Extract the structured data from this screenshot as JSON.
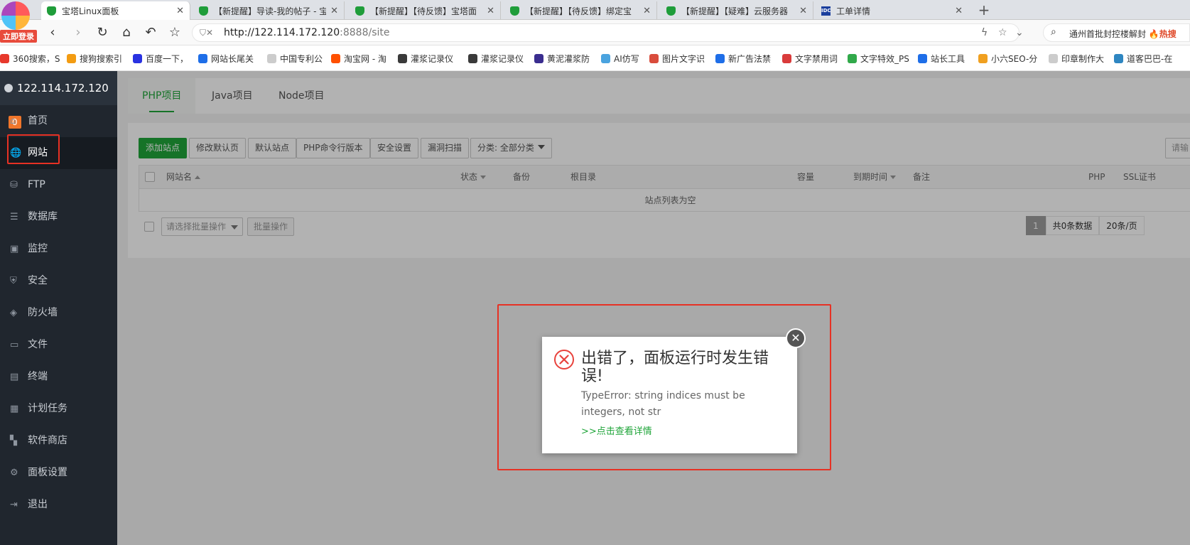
{
  "browser": {
    "login_badge": "立即登录",
    "tabs": [
      {
        "title": "宝塔Linux面板",
        "icon": "shield-icon"
      },
      {
        "title": "【新提醒】导读-我的帖子 - 宝",
        "icon": "shield-icon"
      },
      {
        "title": "【新提醒】【待反馈】宝塔面",
        "icon": "shield-icon"
      },
      {
        "title": "【新提醒】【待反馈】绑定宝",
        "icon": "shield-icon"
      },
      {
        "title": "【新提醒】【疑难】云服务器",
        "icon": "shield-icon"
      },
      {
        "title": "工单详情",
        "icon": "idc-icon"
      }
    ],
    "tab_close": "✕",
    "new_tab": "+",
    "url_host": "http://122.114.172.120",
    "url_path": ":8888/site",
    "search_text": "通州首批封控楼解封",
    "search_hot": "🔥热搜",
    "idc_badge": "IDC",
    "bookmarks": [
      {
        "label": "360搜索，S",
        "color": "#e7392c"
      },
      {
        "label": "搜狗搜索引",
        "color": "#f39c12"
      },
      {
        "label": "百度一下，",
        "color": "#2932e1"
      },
      {
        "label": "网站长尾关",
        "color": "#1e6ee8"
      },
      {
        "label": "中国专利公",
        "color": "#cccccc"
      },
      {
        "label": "淘宝网 - 淘",
        "color": "#ff5000"
      },
      {
        "label": "灌浆记录仪",
        "color": "#3a3a3a"
      },
      {
        "label": "灌浆记录仪",
        "color": "#3a3a3a"
      },
      {
        "label": "黄泥灌浆防",
        "color": "#3a2d8f"
      },
      {
        "label": "AI仿写",
        "color": "#4aa3df"
      },
      {
        "label": "图片文字识",
        "color": "#d94c3c"
      },
      {
        "label": "新广告法禁",
        "color": "#1e6ee8"
      },
      {
        "label": "文字禁用词",
        "color": "#d93b3b"
      },
      {
        "label": "文字特效_PS",
        "color": "#31a94a"
      },
      {
        "label": "站长工具",
        "color": "#1e6ee8"
      },
      {
        "label": "小六SEO-分",
        "color": "#f0a020"
      },
      {
        "label": "印章制作大",
        "color": "#cccccc"
      },
      {
        "label": "道客巴巴-在",
        "color": "#2e86c1"
      }
    ]
  },
  "sidebar": {
    "host": "122.114.172.120",
    "count": "0",
    "items": [
      {
        "label": "首页",
        "icon": "home-icon",
        "glyph": "⌂"
      },
      {
        "label": "网站",
        "icon": "globe-icon",
        "glyph": "🌐"
      },
      {
        "label": "FTP",
        "icon": "ftp-icon",
        "glyph": "⛁"
      },
      {
        "label": "数据库",
        "icon": "database-icon",
        "glyph": "☰"
      },
      {
        "label": "监控",
        "icon": "monitor-icon",
        "glyph": "▣"
      },
      {
        "label": "安全",
        "icon": "security-icon",
        "glyph": "⛨"
      },
      {
        "label": "防火墙",
        "icon": "firewall-icon",
        "glyph": "◈"
      },
      {
        "label": "文件",
        "icon": "folder-icon",
        "glyph": "▭"
      },
      {
        "label": "终端",
        "icon": "terminal-icon",
        "glyph": "▤"
      },
      {
        "label": "计划任务",
        "icon": "calendar-icon",
        "glyph": "▦"
      },
      {
        "label": "软件商店",
        "icon": "apps-icon",
        "glyph": "▚"
      },
      {
        "label": "面板设置",
        "icon": "gear-icon",
        "glyph": "⚙"
      },
      {
        "label": "退出",
        "icon": "logout-icon",
        "glyph": "⇥"
      }
    ]
  },
  "main": {
    "tabs": [
      "PHP项目",
      "Java项目",
      "Node项目"
    ],
    "toolbar": {
      "add_site": "添加站点",
      "edit_default_page": "修改默认页",
      "default_site": "默认站点",
      "php_cli_version": "PHP命令行版本",
      "security_settings": "安全设置",
      "vuln_scan": "漏洞扫描",
      "category": "分类: 全部分类",
      "search_placeholder": "请输"
    },
    "table": {
      "headers": [
        "网站名",
        "状态",
        "备份",
        "根目录",
        "容量",
        "到期时间",
        "备注",
        "PHP",
        "SSL证书"
      ],
      "empty": "站点列表为空"
    },
    "bulk": {
      "select_placeholder": "请选择批量操作",
      "button": "批量操作"
    },
    "pager": {
      "current": "1",
      "total": "共0条数据",
      "per_page": "20条/页"
    }
  },
  "dialog": {
    "title": "出错了，面板运行时发生错误!",
    "message": "TypeError: string indices must be integers, not str",
    "link": ">>点击查看详情",
    "close": "✕"
  }
}
